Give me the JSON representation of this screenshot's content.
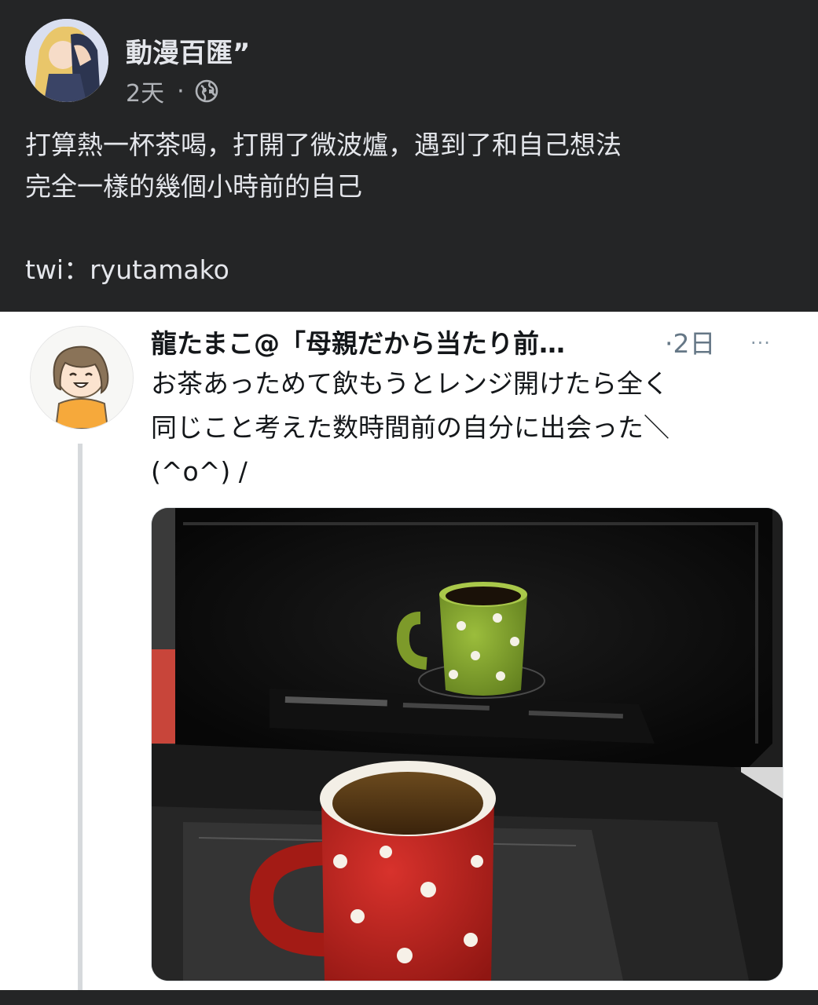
{
  "post": {
    "author": "動漫百匯”",
    "time": "2天",
    "separator": "·",
    "privacy_icon": "globe-icon",
    "text_lines": [
      "打算熱一杯茶喝，打開了微波爐，遇到了和自己想法",
      "完全一樣的幾個小時前的自己"
    ],
    "credit": "twi：ryutamako"
  },
  "tweet": {
    "author": "龍たまこ@「母親だから当たり前…",
    "time": "·2日",
    "more": "···",
    "text_lines": [
      "お茶あっためて飲もうとレンジ開けたら全く",
      "同じこと考えた数時間前の自分に出会った＼",
      "(^o^) /"
    ]
  },
  "colors": {
    "dark_bg": "#242526",
    "dark_text": "#e4e6eb",
    "meta_text": "#b0b3b8",
    "tweet_bg": "#ffffff",
    "tweet_text": "#14171a",
    "tweet_meta": "#657786"
  }
}
